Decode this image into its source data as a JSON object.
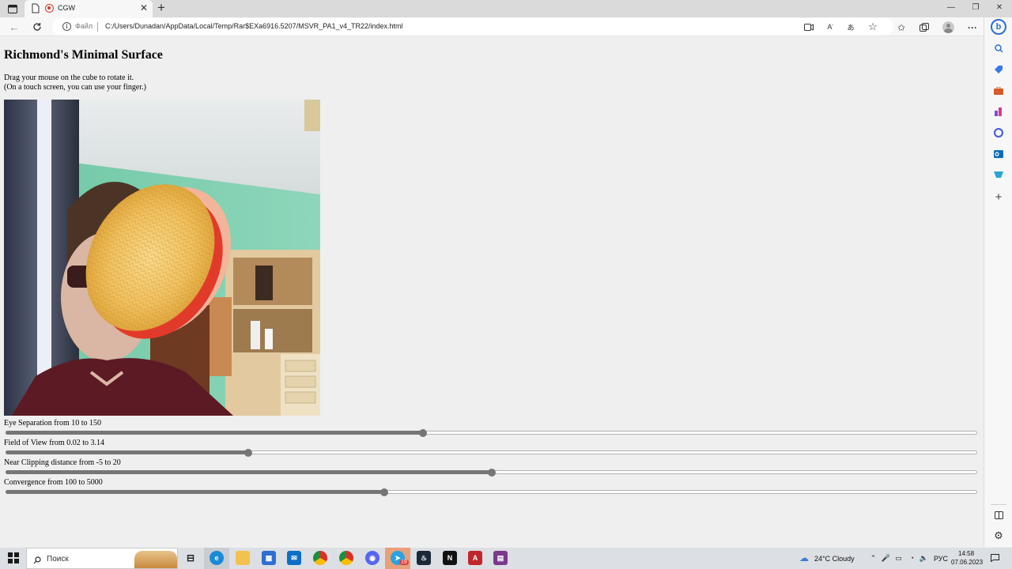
{
  "browser": {
    "tab": {
      "title": "CGW"
    },
    "address": {
      "scheme_label": "Файл",
      "url": "C:/Users/Dunadan/AppData/Local/Temp/Rar$EXa6916.5207/MSVR_PA1_v4_TR22/index.html"
    }
  },
  "page": {
    "title": "Richmond's Minimal Surface",
    "instructions": [
      "Drag your mouse on the cube to rotate it.",
      "(On a touch screen, you can use your finger.)"
    ],
    "sliders": [
      {
        "label": "Eye Separation from 10 to 150",
        "fraction": 0.43
      },
      {
        "label": "Field of View from 0.02 to 3.14",
        "fraction": 0.25
      },
      {
        "label": "Near Clipping distance from -5 to 20",
        "fraction": 0.5
      },
      {
        "label": "Convergence from 100 to 5000",
        "fraction": 0.39
      }
    ]
  },
  "taskbar": {
    "search_placeholder": "Поиск",
    "weather": "24°C  Cloudy",
    "language": "РУС",
    "time": "14:58",
    "date": "07.06.2023",
    "telegram_badge": "19"
  },
  "colors": {
    "slider_fill": "#767676",
    "surface_orange": "#f0c46a",
    "surface_green": "#3fbf6b",
    "surface_red": "#e23a2a"
  }
}
